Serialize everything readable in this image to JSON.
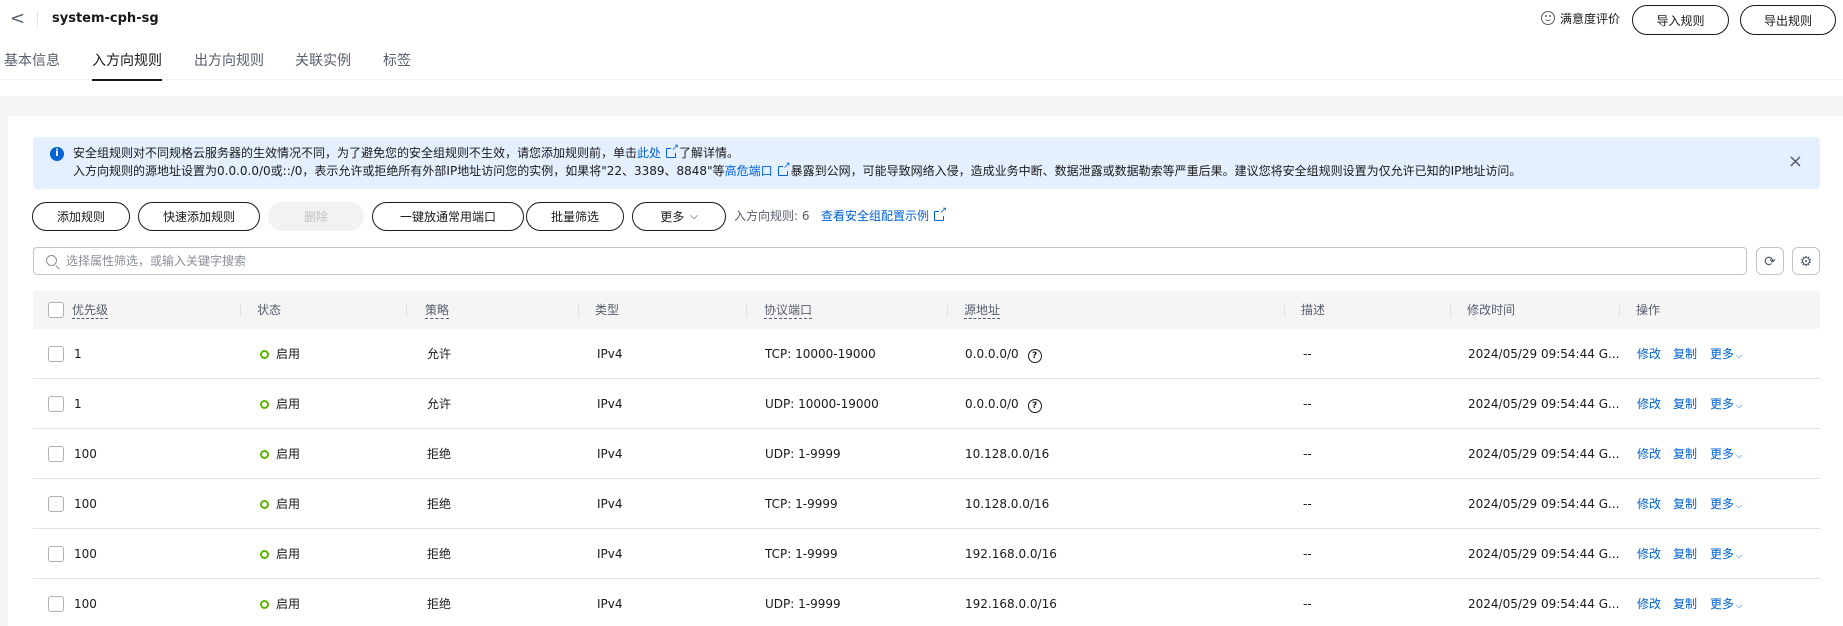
{
  "header": {
    "back_label": "<",
    "title": "system-cph-sg",
    "satisfaction_label": "满意度评价",
    "import_label": "导入规则",
    "export_label": "导出规则"
  },
  "tabs": [
    {
      "label": "基本信息",
      "active": false
    },
    {
      "label": "入方向规则",
      "active": true
    },
    {
      "label": "出方向规则",
      "active": false
    },
    {
      "label": "关联实例",
      "active": false
    },
    {
      "label": "标签",
      "active": false
    }
  ],
  "alert": {
    "icon_label": "i",
    "line1_prefix": "安全组规则对不同规格云服务器的生效情况不同，为了避免您的安全组规则不生效，请您添加规则前，单击",
    "line1_link": "此处",
    "line1_suffix": "了解详情。",
    "line2_prefix": "入方向规则的源地址设置为0.0.0.0/0或::/0，表示允许或拒绝所有外部IP地址访问您的实例，如果将\"22、3389、8848\"等",
    "line2_link": "高危端口",
    "line2_suffix": "暴露到公网，可能导致网络入侵，造成业务中断、数据泄露或数据勒索等严重后果。建议您将安全组规则设置为仅允许已知的IP地址访问。",
    "close_label": "×"
  },
  "toolbar": {
    "add_rule": "添加规则",
    "quick_add": "快速添加规则",
    "delete": "删除",
    "open_common_ports": "一键放通常用端口",
    "batch_filter": "批量筛选",
    "more": "更多",
    "more_chevron": "⌵",
    "rule_count": "入方向规则: 6",
    "example_link": "查看安全组配置示例"
  },
  "search": {
    "placeholder": "选择属性筛选，或输入关键字搜索",
    "refresh_label": "⟳",
    "settings_label": "⚙"
  },
  "table": {
    "columns": [
      "优先级",
      "状态",
      "策略",
      "类型",
      "协议端口",
      "源地址",
      "描述",
      "修改时间",
      "操作"
    ],
    "rows": [
      {
        "priority": "1",
        "status": "启用",
        "policy": "允许",
        "type": "IPv4",
        "port": "TCP: 10000-19000",
        "source": "0.0.0.0/0",
        "help": "?",
        "desc": "--",
        "modified": "2024/05/29 09:54:44 G...",
        "op_edit": "修改",
        "op_copy": "复制",
        "op_more": "更多",
        "op_chevron": "⌵"
      },
      {
        "priority": "1",
        "status": "启用",
        "policy": "允许",
        "type": "IPv4",
        "port": "UDP: 10000-19000",
        "source": "0.0.0.0/0",
        "help": "?",
        "desc": "--",
        "modified": "2024/05/29 09:54:44 G...",
        "op_edit": "修改",
        "op_copy": "复制",
        "op_more": "更多",
        "op_chevron": "⌵"
      },
      {
        "priority": "100",
        "status": "启用",
        "policy": "拒绝",
        "type": "IPv4",
        "port": "UDP: 1-9999",
        "source": "10.128.0.0/16",
        "help": "",
        "desc": "--",
        "modified": "2024/05/29 09:54:44 G...",
        "op_edit": "修改",
        "op_copy": "复制",
        "op_more": "更多",
        "op_chevron": "⌵"
      },
      {
        "priority": "100",
        "status": "启用",
        "policy": "拒绝",
        "type": "IPv4",
        "port": "TCP: 1-9999",
        "source": "10.128.0.0/16",
        "help": "",
        "desc": "--",
        "modified": "2024/05/29 09:54:44 G...",
        "op_edit": "修改",
        "op_copy": "复制",
        "op_more": "更多",
        "op_chevron": "⌵"
      },
      {
        "priority": "100",
        "status": "启用",
        "policy": "拒绝",
        "type": "IPv4",
        "port": "TCP: 1-9999",
        "source": "192.168.0.0/16",
        "help": "",
        "desc": "--",
        "modified": "2024/05/29 09:54:44 G...",
        "op_edit": "修改",
        "op_copy": "复制",
        "op_more": "更多",
        "op_chevron": "⌵"
      },
      {
        "priority": "100",
        "status": "启用",
        "policy": "拒绝",
        "type": "IPv4",
        "port": "UDP: 1-9999",
        "source": "192.168.0.0/16",
        "help": "",
        "desc": "--",
        "modified": "2024/05/29 09:54:44 G...",
        "op_edit": "修改",
        "op_copy": "复制",
        "op_more": "更多",
        "op_chevron": "⌵"
      }
    ]
  },
  "colors": {
    "link": "#0062d3",
    "status_enabled": "#5bb400",
    "alert_bg": "#e4f0ff"
  }
}
